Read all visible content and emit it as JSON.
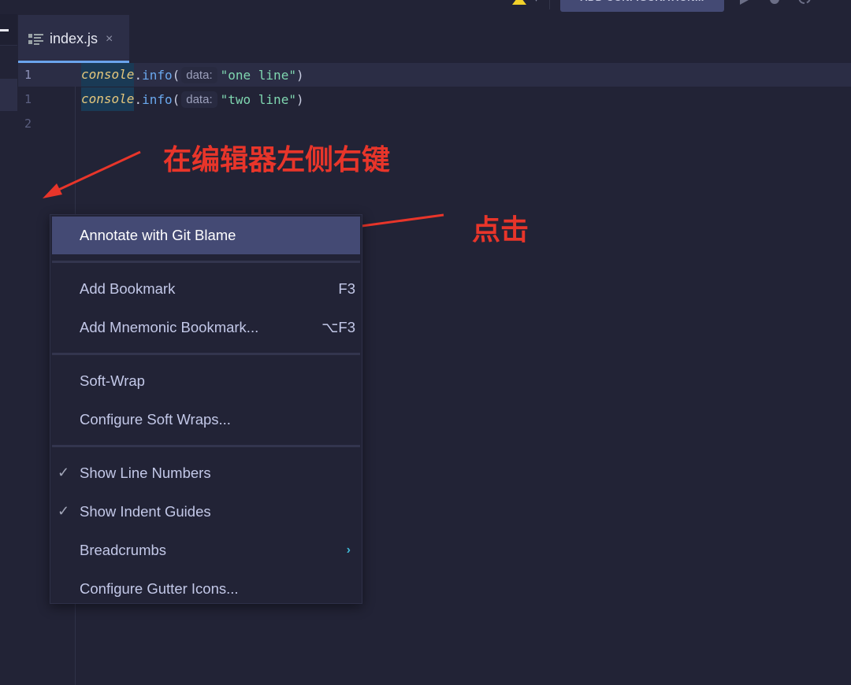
{
  "toolbar": {
    "add_configuration_label": "ADD CONFIGURATION...",
    "icons": [
      "warning-user-icon",
      "run-icon",
      "debug-icon",
      "profile-icon",
      "stop-icon"
    ],
    "colors": {
      "button_bg": "#444a74",
      "warning": "#f2d12a"
    }
  },
  "tab": {
    "label": "index.js",
    "close_glyph": "×",
    "icon": "structure-icon",
    "underline_color": "#6aa4ec"
  },
  "editor": {
    "lines": [
      {
        "number": "1",
        "object": "console",
        "dot": ".",
        "method": "info",
        "open": "(",
        "hint": "data:",
        "string": "\"one line\"",
        "close": ")"
      },
      {
        "number": "1",
        "object": "console",
        "dot": ".",
        "method": "info",
        "open": "(",
        "hint": "data:",
        "string": "\"two line\"",
        "close": ")"
      },
      {
        "number": "2"
      }
    ],
    "colors": {
      "keyword": "#e6c77c",
      "method": "#6aa8ee",
      "string": "#7fd6b0"
    }
  },
  "annotations": {
    "right_click_hint": "在编辑器左侧右键",
    "click_hint": "点击",
    "color": "#e8352a"
  },
  "context_menu": {
    "items": [
      {
        "label": "Annotate with Git Blame",
        "selected": true
      },
      {
        "label": "Add Bookmark",
        "shortcut": "F3"
      },
      {
        "label": "Add Mnemonic Bookmark...",
        "shortcut": "⌥F3"
      },
      {
        "label": "Soft-Wrap"
      },
      {
        "label": "Configure Soft Wraps..."
      },
      {
        "label": "Show Line Numbers",
        "checked": true,
        "check_glyph": "✓"
      },
      {
        "label": "Show Indent Guides",
        "checked": true,
        "check_glyph": "✓"
      },
      {
        "label": "Breadcrumbs",
        "submenu_glyph": "›"
      },
      {
        "label": "Configure Gutter Icons..."
      }
    ],
    "colors": {
      "selected_bg": "#444a74",
      "submenu_arrow": "#3fb6d4"
    }
  }
}
